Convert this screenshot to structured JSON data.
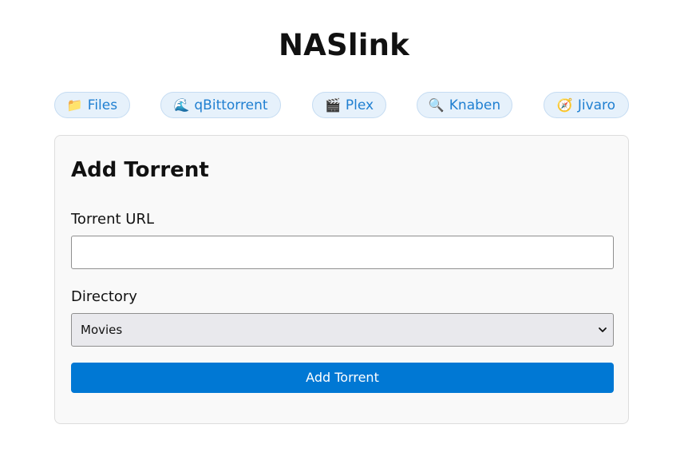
{
  "app": {
    "title": "NASlink"
  },
  "nav": {
    "links": [
      {
        "icon": "📁",
        "icon_name": "folder-icon",
        "label": "Files"
      },
      {
        "icon": "🌊",
        "icon_name": "wave-icon",
        "label": "qBittorrent"
      },
      {
        "icon": "🎬",
        "icon_name": "clapper-board-icon",
        "label": "Plex"
      },
      {
        "icon": "🔍",
        "icon_name": "magnifier-icon",
        "label": "Knaben"
      },
      {
        "icon": "🧭",
        "icon_name": "compass-icon",
        "label": "Jivaro"
      }
    ]
  },
  "form": {
    "title": "Add Torrent",
    "url_label": "Torrent URL",
    "url_value": "",
    "url_placeholder": "",
    "directory_label": "Directory",
    "directory_selected": "Movies",
    "submit_label": "Add Torrent"
  },
  "colors": {
    "accent": "#0078d4",
    "nav_link_text": "#1f7fd1",
    "nav_link_bg": "#e6f1fb",
    "card_bg": "#f9f9f9"
  }
}
